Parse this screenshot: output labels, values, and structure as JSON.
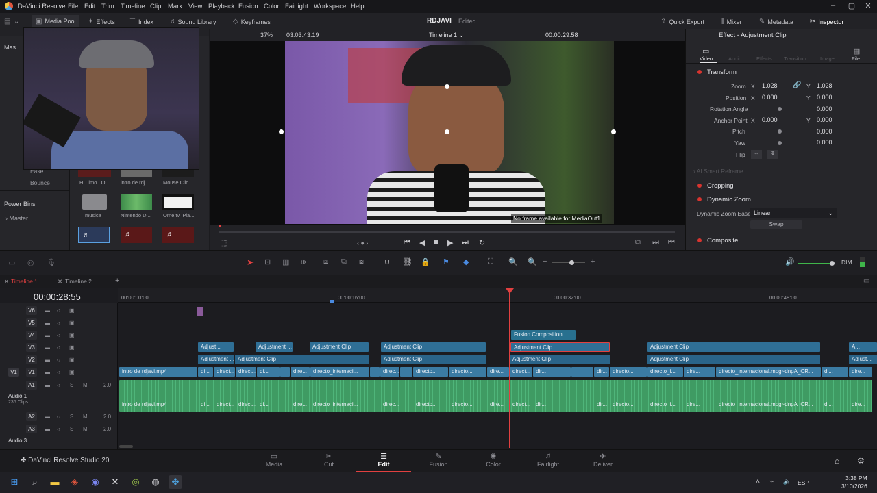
{
  "window": {
    "app_name": "DaVinci Resolve",
    "menu": [
      "File",
      "Edit",
      "Trim",
      "Timeline",
      "Clip",
      "Mark",
      "View",
      "Playback",
      "Fusion",
      "Color",
      "Fairlight",
      "Workspace",
      "Help"
    ]
  },
  "toolbar": {
    "media_pool": "Media Pool",
    "effects": "Effects",
    "index": "Index",
    "sound_library": "Sound Library",
    "keyframes": "Keyframes",
    "project": "RDJAVI",
    "project_status": "Edited",
    "quick_export": "Quick Export",
    "mixer": "Mixer",
    "metadata": "Metadata",
    "inspector": "Inspector"
  },
  "viewer": {
    "zoom": "37%",
    "source_tc": "03:03:43:19",
    "timeline_name": "Timeline 1",
    "record_tc": "00:00:29:58",
    "overlay_msg": "No frame available for MediaOut1"
  },
  "media_pool": {
    "left_items": [
      "Mas",
      "Ease",
      "Bounce"
    ],
    "power_bins": "Power Bins",
    "master": "Master",
    "thumbs": [
      {
        "label": "H Tilmo LO..."
      },
      {
        "label": "intro de rdj..."
      },
      {
        "label": "Mouse Clic..."
      },
      {
        "label": "musica"
      },
      {
        "label": "Nintendo D..."
      },
      {
        "label": "Ome.tv_Pla..."
      },
      {
        "label": ""
      },
      {
        "label": ""
      },
      {
        "label": ""
      }
    ]
  },
  "inspector": {
    "title": "Effect - Adjustment Clip",
    "tabs": [
      "Video",
      "Audio",
      "Effects",
      "Transition",
      "Image",
      "File"
    ],
    "transform": "Transform",
    "zoom_label": "Zoom",
    "zoom_x": "1.028",
    "zoom_y": "1.028",
    "position_label": "Position",
    "pos_x": "0.000",
    "pos_y": "0.000",
    "rotation_label": "Rotation Angle",
    "rotation": "0.000",
    "anchor_label": "Anchor Point",
    "anchor_x": "0.000",
    "anchor_y": "0.000",
    "pitch_label": "Pitch",
    "pitch": "0.000",
    "yaw_label": "Yaw",
    "yaw": "0.000",
    "flip_label": "Flip",
    "ai_reframe": "AI Smart Reframe",
    "cropping": "Cropping",
    "dynamic_zoom": "Dynamic Zoom",
    "dz_ease_label": "Dynamic Zoom Ease",
    "dz_ease_value": "Linear",
    "swap": "Swap",
    "composite": "Composite",
    "x": "X",
    "y": "Y"
  },
  "timeline": {
    "tabs": [
      "Timeline 1",
      "Timeline 2"
    ],
    "timecode": "00:00:28:55",
    "ruler": [
      "00:00:00:00",
      "00:00:16:00",
      "00:00:32:00",
      "00:00:48:00"
    ],
    "dim": "DIM",
    "tracks": {
      "v6": "V6",
      "v5": "V5",
      "v4": "V4",
      "v3": "V3",
      "v2": "V2",
      "v1": "V1",
      "v1src": "V1",
      "a1": "A1",
      "a2": "A2",
      "a3": "A3",
      "audio1": "Audio 1",
      "audio1_count": "236 Clips",
      "audio3": "Audio 3",
      "vol": "2.0"
    },
    "clips": {
      "fusion": "Fusion Composition",
      "adj_short": "Adjust...",
      "adj_short2": "Adjustment ...",
      "adj": "Adjustment Clip",
      "intro": "intro de rdjavi.mp4",
      "direct_short": "direct...",
      "direc": "direc...",
      "di": "di...",
      "dire": "dire...",
      "directo": "directo...",
      "directo_i": "directo_i...",
      "dir": "dir...",
      "directo_inter": "directo_internaci...",
      "directo_long": "directo_internacional.mpg~dnpA_CR...",
      "a_short": "A...",
      "adjust_short": "Adjust..."
    }
  },
  "pages": [
    "Media",
    "Cut",
    "Edit",
    "Fusion",
    "Color",
    "Fairlight",
    "Deliver"
  ],
  "brand": "DaVinci Resolve Studio 20",
  "taskbar": {
    "lang": "ESP",
    "time": "3:38 PM",
    "date": "3/10/2026"
  }
}
